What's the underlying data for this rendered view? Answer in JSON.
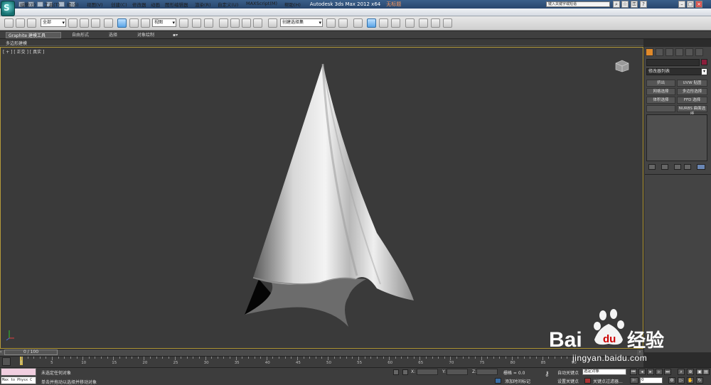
{
  "window": {
    "title": "Autodesk 3ds Max  2012 x64",
    "document": "无标题",
    "search_placeholder": "键入关键字或短语"
  },
  "menu": [
    "编辑(E)",
    "工具(T)",
    "组(G)",
    "视图(V)",
    "创建(C)",
    "修改器",
    "动画",
    "图形编辑器",
    "渲染(R)",
    "自定义(U)",
    "MAXScript(M)",
    "帮助(H)"
  ],
  "toolbar": {
    "selection_filter": "全部",
    "reference_coord": "视图",
    "named_selection": "创建选择集"
  },
  "ribbon": {
    "tabs": [
      "Graphite 建模工具",
      "自由形式",
      "选择",
      "对象绘制"
    ],
    "sub_label": "多边形建模"
  },
  "viewport": {
    "label": "[ + ] [ 正交 ] [ 真实 ]",
    "border_color": "#b59b3a",
    "bg_color": "#3a3a3a"
  },
  "command_panel": {
    "modifier_list": "修改器列表",
    "buttons": [
      "挤出",
      "UVW 贴图",
      "网格选择",
      "多边形选择",
      "体积选择",
      "FFD 选择",
      "",
      "NURBS 曲面选择"
    ]
  },
  "timeline": {
    "frame_display": "0 / 100",
    "ticks": [
      0,
      5,
      10,
      15,
      20,
      25,
      30,
      35,
      40,
      45,
      50,
      55,
      60,
      65,
      70,
      75,
      80,
      85,
      90
    ]
  },
  "status": {
    "maxscript_text": "Max to Physx C",
    "selection_status": "未选定任何对象",
    "prompt": "单击并拖动以选择并移动对象",
    "x_label": "X:",
    "y_label": "Y:",
    "z_label": "Z:",
    "grid": "栅格 = 0.0",
    "auto_key": "自动关键点",
    "selected_object": "选定对象",
    "set_key": "设置关键点",
    "key_filters": "关键点过滤器...",
    "add_time_tag": "添加时间标记",
    "current_frame": "0"
  },
  "watermark": {
    "brand": "Bai",
    "paw": "du",
    "cn": "经验",
    "url": "jingyan.baidu.com"
  }
}
